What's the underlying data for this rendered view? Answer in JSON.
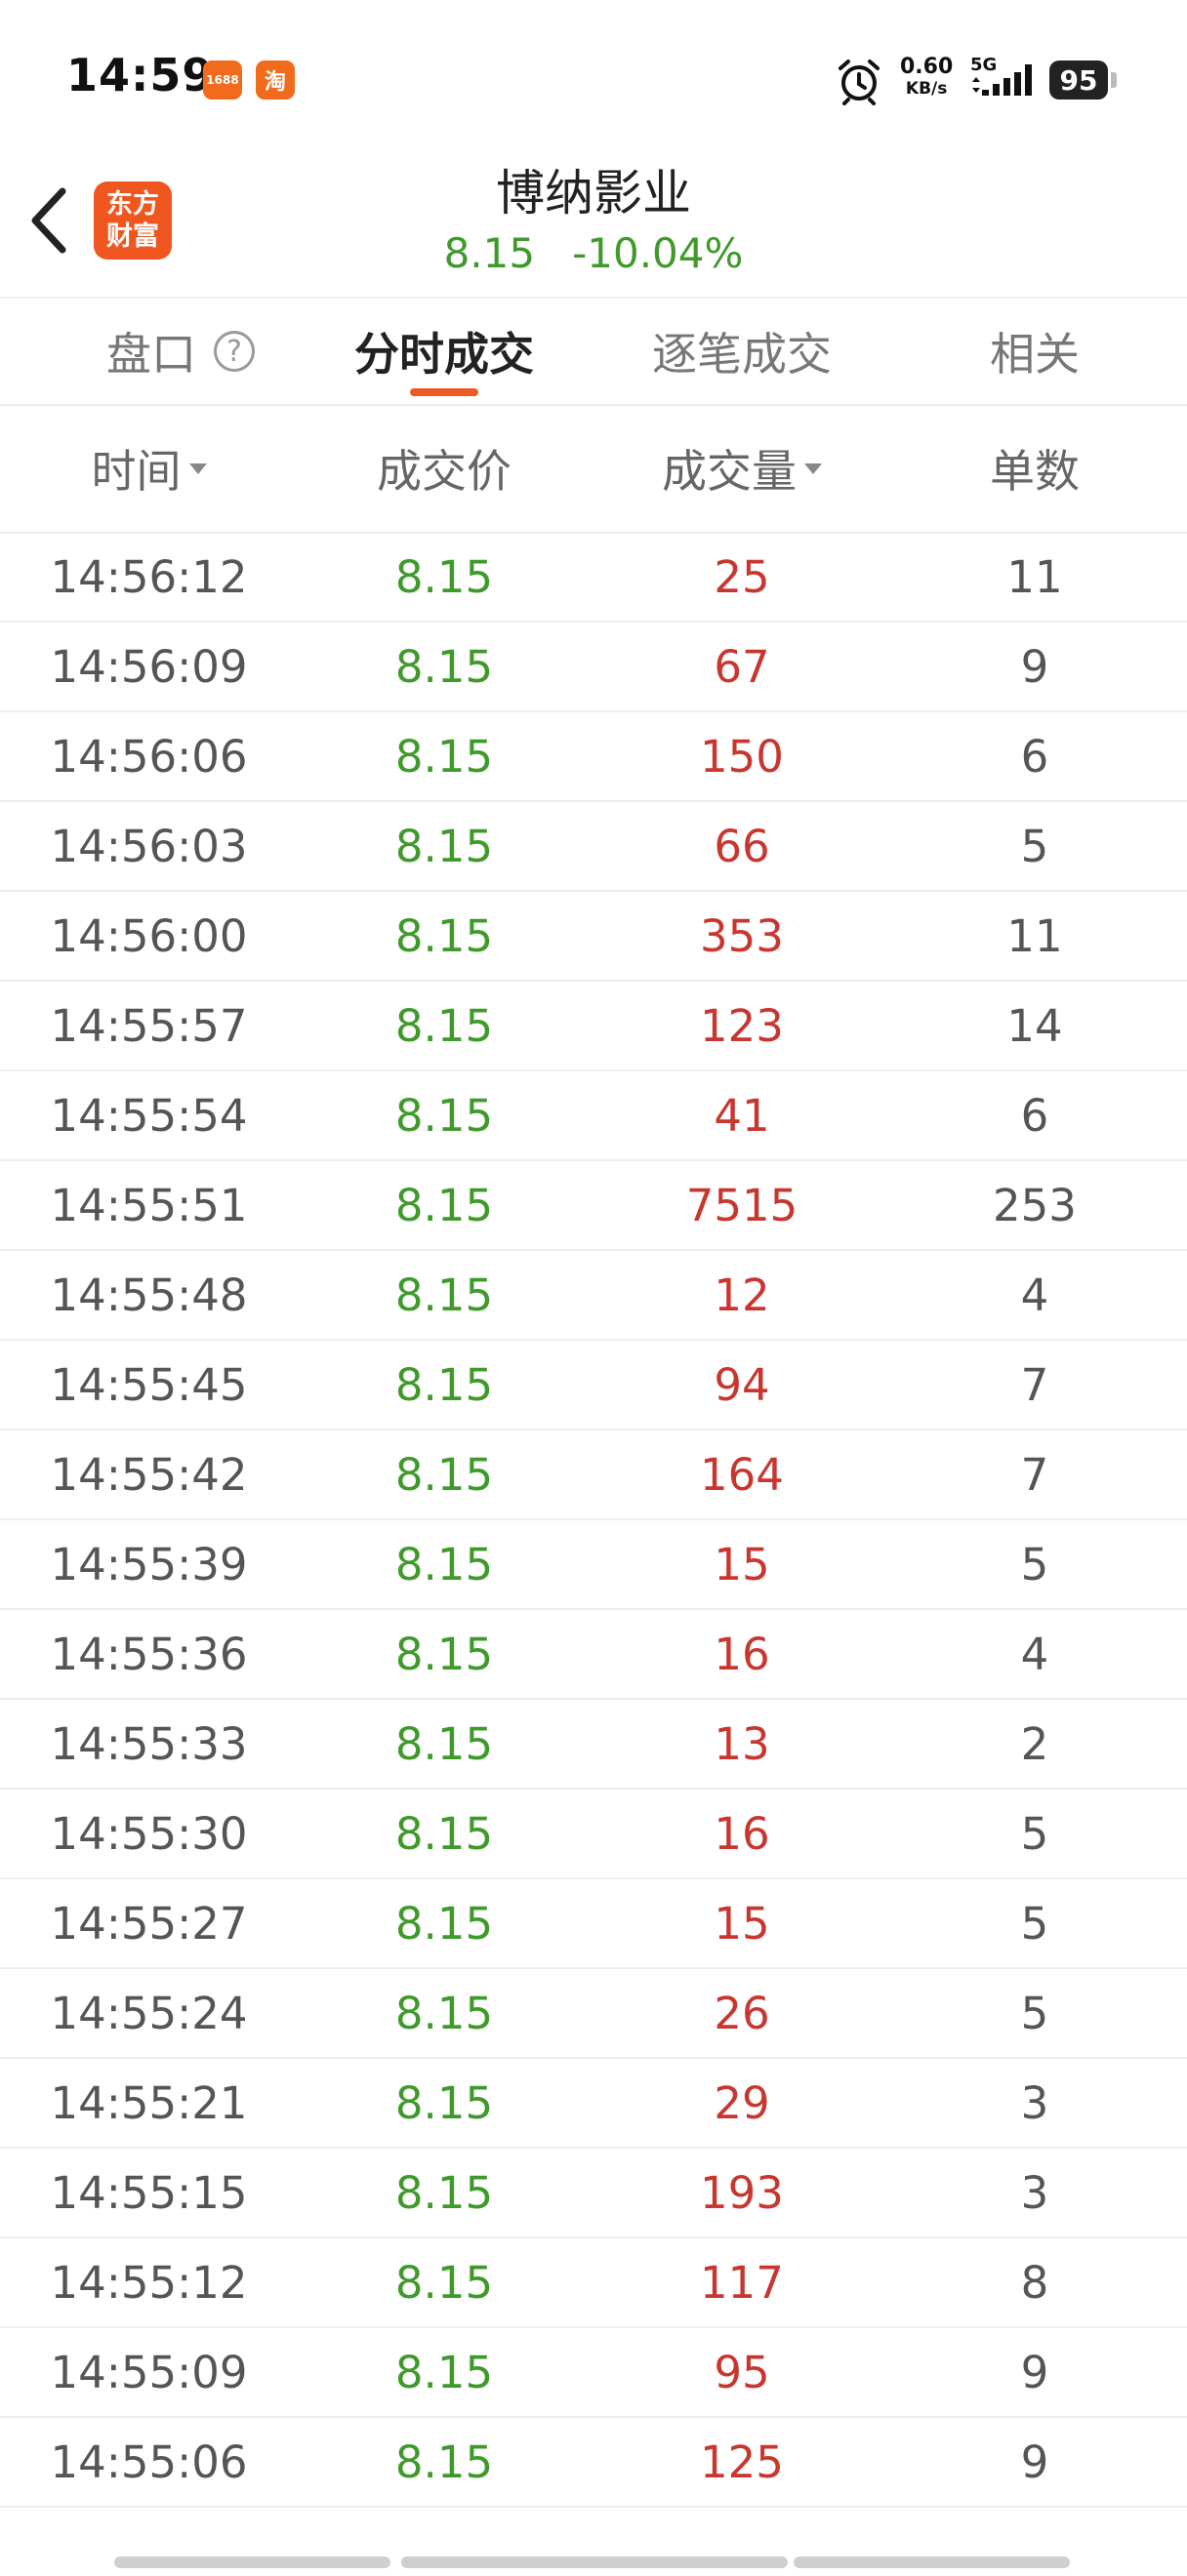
{
  "status_bar": {
    "time": "14:59",
    "app_icon_1": "1688",
    "app_icon_2": "淘",
    "net_speed_value": "0.60",
    "net_speed_unit": "KB/s",
    "network_type": "5G",
    "battery": "95"
  },
  "header": {
    "logo_line1": "东方",
    "logo_line2": "财富",
    "stock_name": "博纳影业",
    "price": "8.15",
    "change_pct": "-10.04%"
  },
  "tabs": [
    {
      "label": "盘口",
      "active": false
    },
    {
      "label": "分时成交",
      "active": true
    },
    {
      "label": "逐笔成交",
      "active": false
    },
    {
      "label": "相关",
      "active": false
    }
  ],
  "columns": {
    "time": "时间",
    "price": "成交价",
    "volume": "成交量",
    "count": "单数"
  },
  "rows": [
    {
      "time": "14:56:12",
      "price": "8.15",
      "volume": "25",
      "count": "11"
    },
    {
      "time": "14:56:09",
      "price": "8.15",
      "volume": "67",
      "count": "9"
    },
    {
      "time": "14:56:06",
      "price": "8.15",
      "volume": "150",
      "count": "6"
    },
    {
      "time": "14:56:03",
      "price": "8.15",
      "volume": "66",
      "count": "5"
    },
    {
      "time": "14:56:00",
      "price": "8.15",
      "volume": "353",
      "count": "11"
    },
    {
      "time": "14:55:57",
      "price": "8.15",
      "volume": "123",
      "count": "14"
    },
    {
      "time": "14:55:54",
      "price": "8.15",
      "volume": "41",
      "count": "6"
    },
    {
      "time": "14:55:51",
      "price": "8.15",
      "volume": "7515",
      "count": "253"
    },
    {
      "time": "14:55:48",
      "price": "8.15",
      "volume": "12",
      "count": "4"
    },
    {
      "time": "14:55:45",
      "price": "8.15",
      "volume": "94",
      "count": "7"
    },
    {
      "time": "14:55:42",
      "price": "8.15",
      "volume": "164",
      "count": "7"
    },
    {
      "time": "14:55:39",
      "price": "8.15",
      "volume": "15",
      "count": "5"
    },
    {
      "time": "14:55:36",
      "price": "8.15",
      "volume": "16",
      "count": "4"
    },
    {
      "time": "14:55:33",
      "price": "8.15",
      "volume": "13",
      "count": "2"
    },
    {
      "time": "14:55:30",
      "price": "8.15",
      "volume": "16",
      "count": "5"
    },
    {
      "time": "14:55:27",
      "price": "8.15",
      "volume": "15",
      "count": "5"
    },
    {
      "time": "14:55:24",
      "price": "8.15",
      "volume": "26",
      "count": "5"
    },
    {
      "time": "14:55:21",
      "price": "8.15",
      "volume": "29",
      "count": "3"
    },
    {
      "time": "14:55:15",
      "price": "8.15",
      "volume": "193",
      "count": "3"
    },
    {
      "time": "14:55:12",
      "price": "8.15",
      "volume": "117",
      "count": "8"
    },
    {
      "time": "14:55:09",
      "price": "8.15",
      "volume": "95",
      "count": "9"
    },
    {
      "time": "14:55:06",
      "price": "8.15",
      "volume": "125",
      "count": "9"
    }
  ],
  "colors": {
    "down_green": "#3f9a2b",
    "volume_red": "#c8362f",
    "accent_orange": "#ee5a24"
  },
  "icons": {
    "back": "chevron-left-icon",
    "help": "question-circle-icon",
    "alarm": "alarm-clock-icon",
    "signal": "signal-bars-icon",
    "battery": "battery-icon",
    "sort": "caret-down-icon"
  }
}
